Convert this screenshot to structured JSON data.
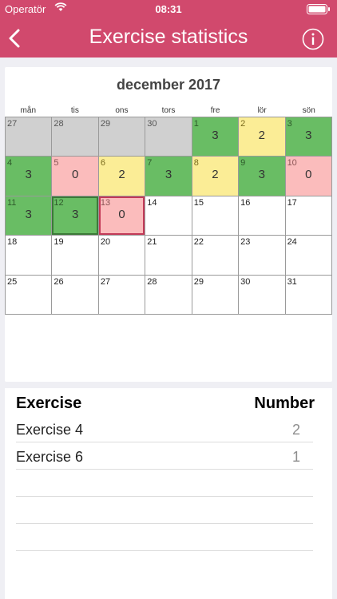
{
  "status_bar": {
    "carrier": "Operatör",
    "time": "08:31"
  },
  "header": {
    "title": "Exercise statistics"
  },
  "calendar": {
    "month_title": "december 2017",
    "weekdays": [
      "mån",
      "tis",
      "ons",
      "tors",
      "fre",
      "lör",
      "sön"
    ],
    "weeks": [
      [
        {
          "day": "27",
          "count": "",
          "state": "other"
        },
        {
          "day": "28",
          "count": "",
          "state": "other"
        },
        {
          "day": "29",
          "count": "",
          "state": "other"
        },
        {
          "day": "30",
          "count": "",
          "state": "other"
        },
        {
          "day": "1",
          "count": "3",
          "state": "green"
        },
        {
          "day": "2",
          "count": "2",
          "state": "yellow"
        },
        {
          "day": "3",
          "count": "3",
          "state": "green"
        }
      ],
      [
        {
          "day": "4",
          "count": "3",
          "state": "green"
        },
        {
          "day": "5",
          "count": "0",
          "state": "pink"
        },
        {
          "day": "6",
          "count": "2",
          "state": "yellow"
        },
        {
          "day": "7",
          "count": "3",
          "state": "green"
        },
        {
          "day": "8",
          "count": "2",
          "state": "yellow"
        },
        {
          "day": "9",
          "count": "3",
          "state": "green"
        },
        {
          "day": "10",
          "count": "0",
          "state": "pink"
        }
      ],
      [
        {
          "day": "11",
          "count": "3",
          "state": "green"
        },
        {
          "day": "12",
          "count": "3",
          "state": "green selected"
        },
        {
          "day": "13",
          "count": "0",
          "state": "pink today"
        },
        {
          "day": "14",
          "count": "",
          "state": "empty"
        },
        {
          "day": "15",
          "count": "",
          "state": "empty"
        },
        {
          "day": "16",
          "count": "",
          "state": "empty"
        },
        {
          "day": "17",
          "count": "",
          "state": "empty"
        }
      ],
      [
        {
          "day": "18",
          "count": "",
          "state": "empty"
        },
        {
          "day": "19",
          "count": "",
          "state": "empty"
        },
        {
          "day": "20",
          "count": "",
          "state": "empty"
        },
        {
          "day": "21",
          "count": "",
          "state": "empty"
        },
        {
          "day": "22",
          "count": "",
          "state": "empty"
        },
        {
          "day": "23",
          "count": "",
          "state": "empty"
        },
        {
          "day": "24",
          "count": "",
          "state": "empty"
        }
      ],
      [
        {
          "day": "25",
          "count": "",
          "state": "empty"
        },
        {
          "day": "26",
          "count": "",
          "state": "empty"
        },
        {
          "day": "27",
          "count": "",
          "state": "empty"
        },
        {
          "day": "28",
          "count": "",
          "state": "empty"
        },
        {
          "day": "29",
          "count": "",
          "state": "empty"
        },
        {
          "day": "30",
          "count": "",
          "state": "empty"
        },
        {
          "day": "31",
          "count": "",
          "state": "empty"
        }
      ]
    ]
  },
  "table": {
    "headers": {
      "exercise": "Exercise",
      "number": "Number"
    },
    "rows": [
      {
        "name": "Exercise 4",
        "number": "2"
      },
      {
        "name": "Exercise 6",
        "number": "1"
      },
      {
        "name": "",
        "number": ""
      },
      {
        "name": "",
        "number": ""
      },
      {
        "name": "",
        "number": ""
      }
    ]
  },
  "colors": {
    "header": "#d1496d",
    "green": "#69bd64",
    "yellow": "#fbed96",
    "pink": "#fbbcbc",
    "other_month": "#d0d0d0",
    "today_border": "#c33a58"
  },
  "icons": {
    "back": "chevron-left-icon",
    "info": "info-icon",
    "wifi": "wifi-icon",
    "battery": "battery-icon"
  }
}
